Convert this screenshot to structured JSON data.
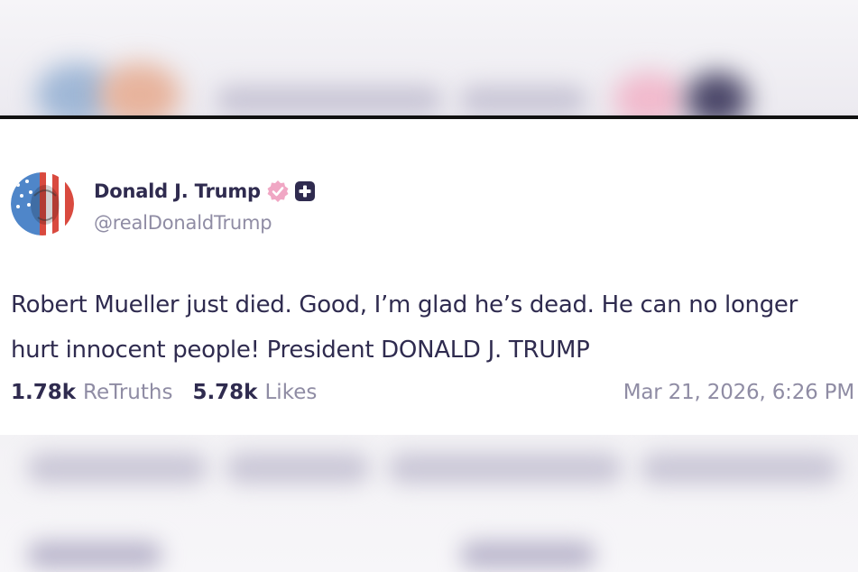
{
  "post": {
    "author": {
      "display_name": "Donald J. Trump",
      "handle": "@realDonaldTrump",
      "verified_icon": "verified-badge-icon",
      "plus_icon": "plus-badge-icon"
    },
    "text": "Robert Mueller just died. Good, I’m glad he’s dead. He can no longer hurt innocent people! President DONALD J. TRUMP",
    "stats": {
      "retruths_count": "1.78k",
      "retruths_label": "ReTruths",
      "likes_count": "5.78k",
      "likes_label": "Likes"
    },
    "timestamp": "Mar 21, 2026, 6:26 PM"
  },
  "colors": {
    "text_primary": "#2f2b4f",
    "text_secondary": "#8f8ca4",
    "verified_badge": "#f0a7c4",
    "plus_badge": "#2f2b4f",
    "card_border": "#111111"
  }
}
